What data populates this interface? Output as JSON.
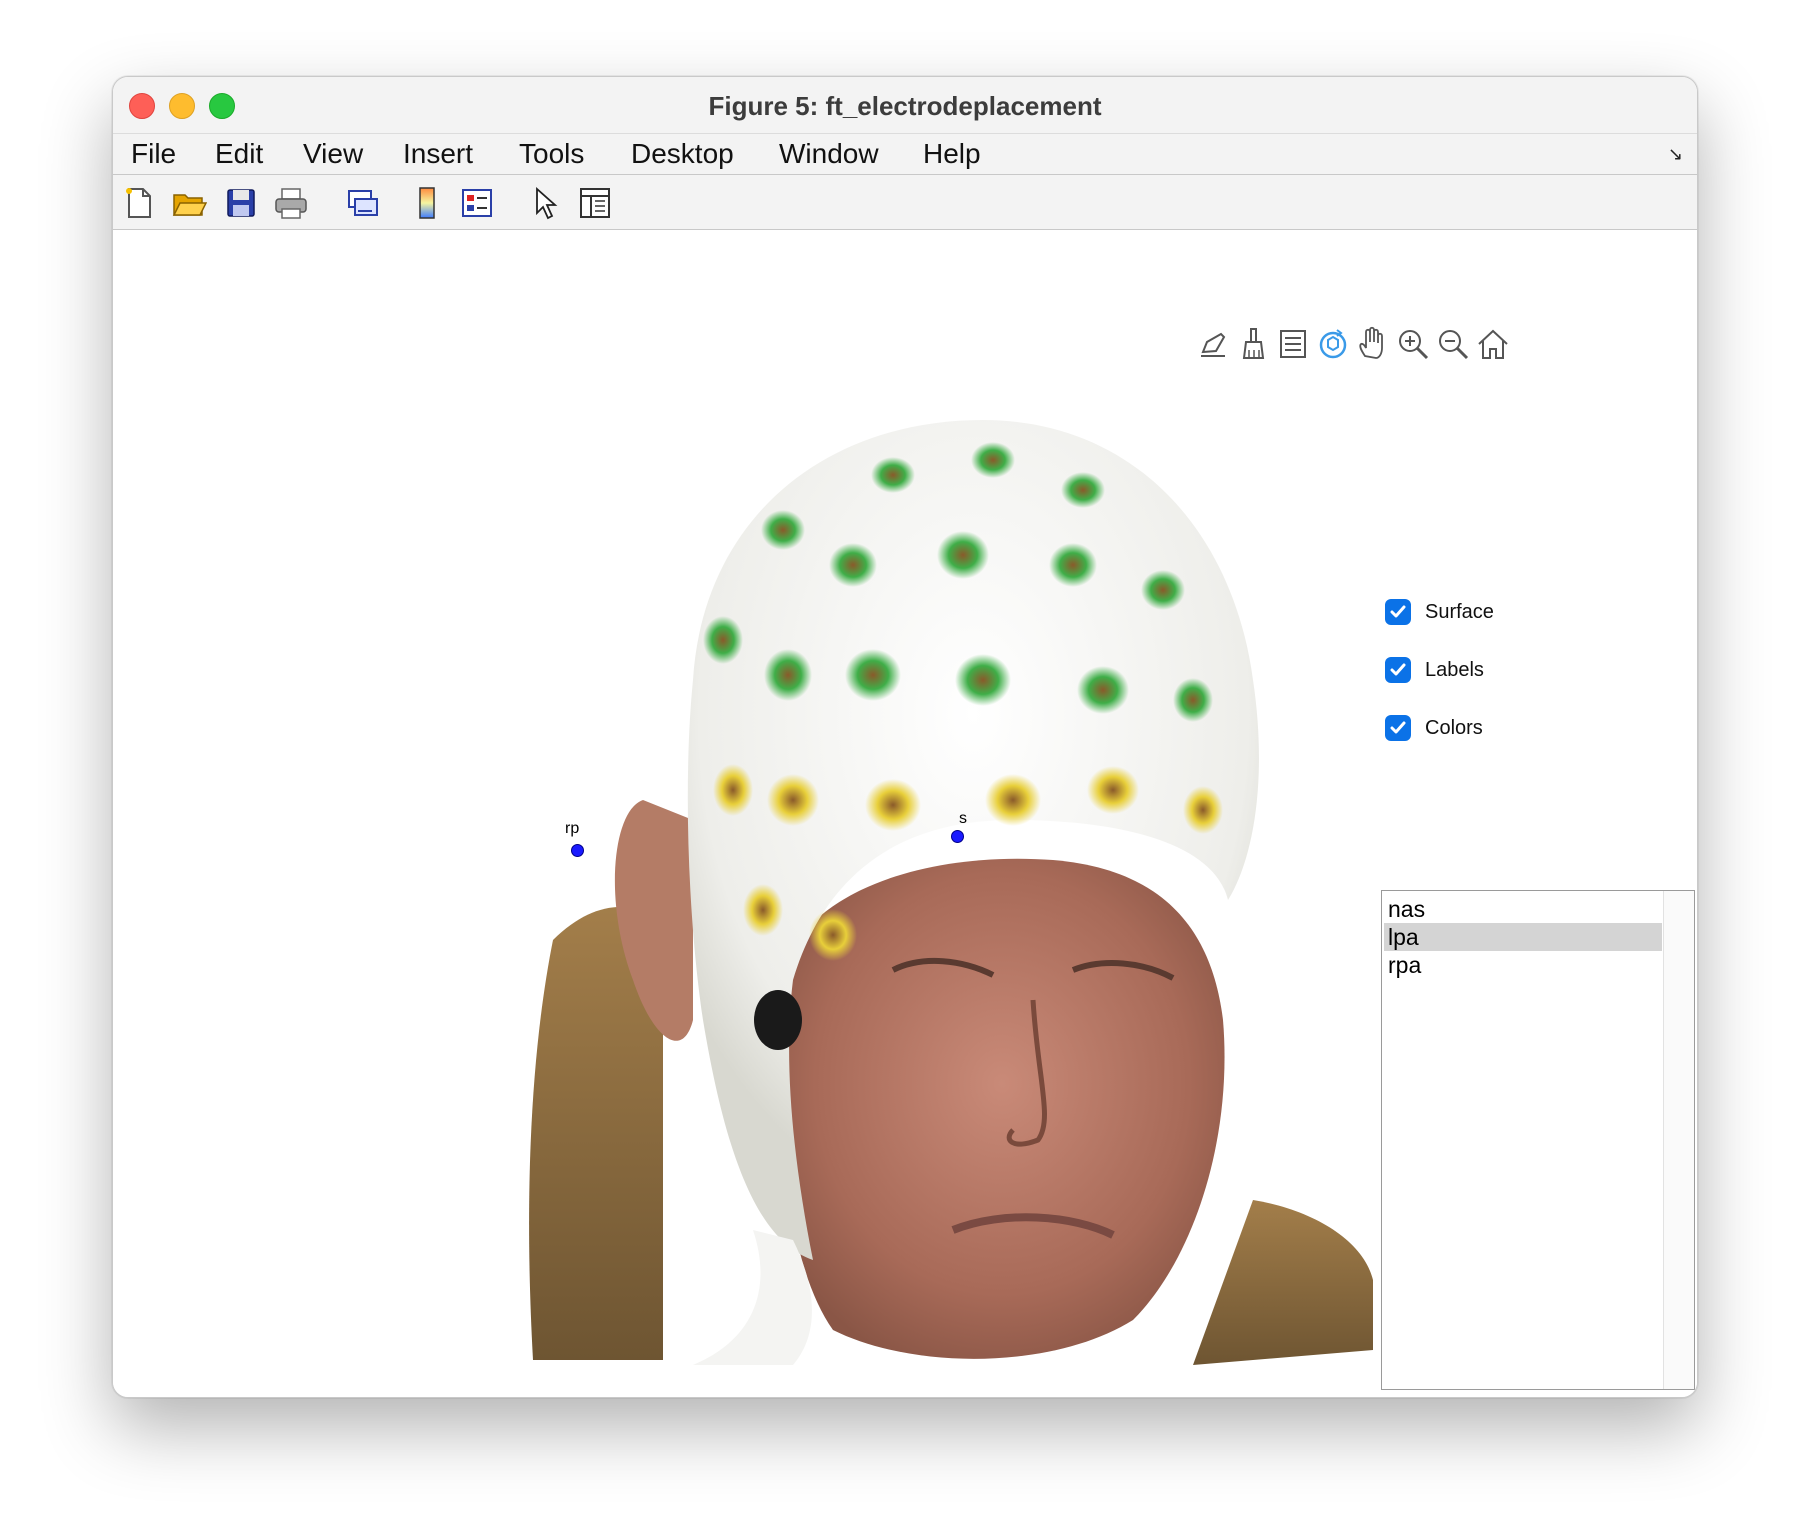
{
  "window": {
    "title": "Figure 5: ft_electrodeplacement"
  },
  "menubar": {
    "items": [
      "File",
      "Edit",
      "View",
      "Insert",
      "Tools",
      "Desktop",
      "Window",
      "Help"
    ],
    "corner_icon": "dock-arrow-icon"
  },
  "toolbar": {
    "icons": [
      "new-figure-icon",
      "open-file-icon",
      "save-icon",
      "print-icon",
      "link-plot-icon",
      "insert-colorbar-icon",
      "insert-legend-icon",
      "edit-plot-arrow-icon",
      "property-inspector-icon"
    ]
  },
  "axes_toolbar": {
    "icons": [
      "export-icon",
      "brush-icon",
      "data-tips-icon",
      "rotate-3d-icon",
      "pan-icon",
      "zoom-in-icon",
      "zoom-out-icon",
      "home-icon"
    ]
  },
  "markers": [
    {
      "label": "rp",
      "color": "#1a1aff"
    },
    {
      "label": "s",
      "color": "#1a1aff"
    }
  ],
  "checkboxes": [
    {
      "label": "Surface",
      "checked": true
    },
    {
      "label": "Labels",
      "checked": true
    },
    {
      "label": "Colors",
      "checked": true
    }
  ],
  "listbox": {
    "items": [
      "nas",
      "lpa",
      "rpa"
    ],
    "selected": "lpa"
  },
  "colors": {
    "accent": "#0b72e7",
    "selection": "#d4d4d4"
  }
}
